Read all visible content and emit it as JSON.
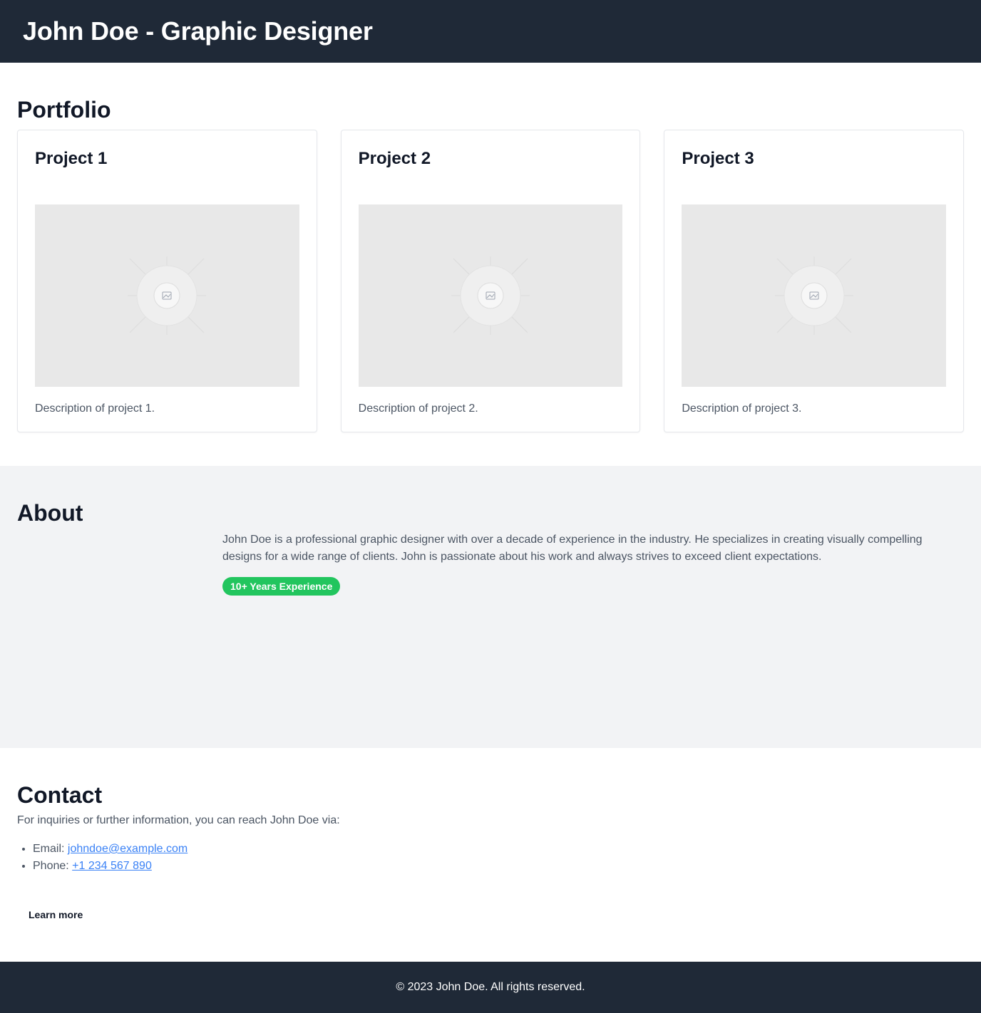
{
  "header": {
    "title": "John Doe - Graphic Designer"
  },
  "portfolio": {
    "title": "Portfolio",
    "projects": [
      {
        "title": "Project 1",
        "description": "Description of project 1."
      },
      {
        "title": "Project 2",
        "description": "Description of project 2."
      },
      {
        "title": "Project 3",
        "description": "Description of project 3."
      }
    ]
  },
  "about": {
    "title": "About",
    "text": "John Doe is a professional graphic designer with over a decade of experience in the industry. He specializes in creating visually compelling designs for a wide range of clients. John is passionate about his work and always strives to exceed client expectations.",
    "badge": "10+ Years Experience",
    "badge_color": "#22c55e"
  },
  "contact": {
    "title": "Contact",
    "intro": "For inquiries or further information, you can reach John Doe via:",
    "email_label": "Email:",
    "email": "johndoe@example.com",
    "phone_label": "Phone:",
    "phone": "+1 234 567 890",
    "button": "Learn more"
  },
  "footer": {
    "text": "© 2023 John Doe. All rights reserved."
  },
  "colors": {
    "header_bg": "#1f2937",
    "link": "#3b82f6",
    "about_bg": "#f2f3f5"
  }
}
